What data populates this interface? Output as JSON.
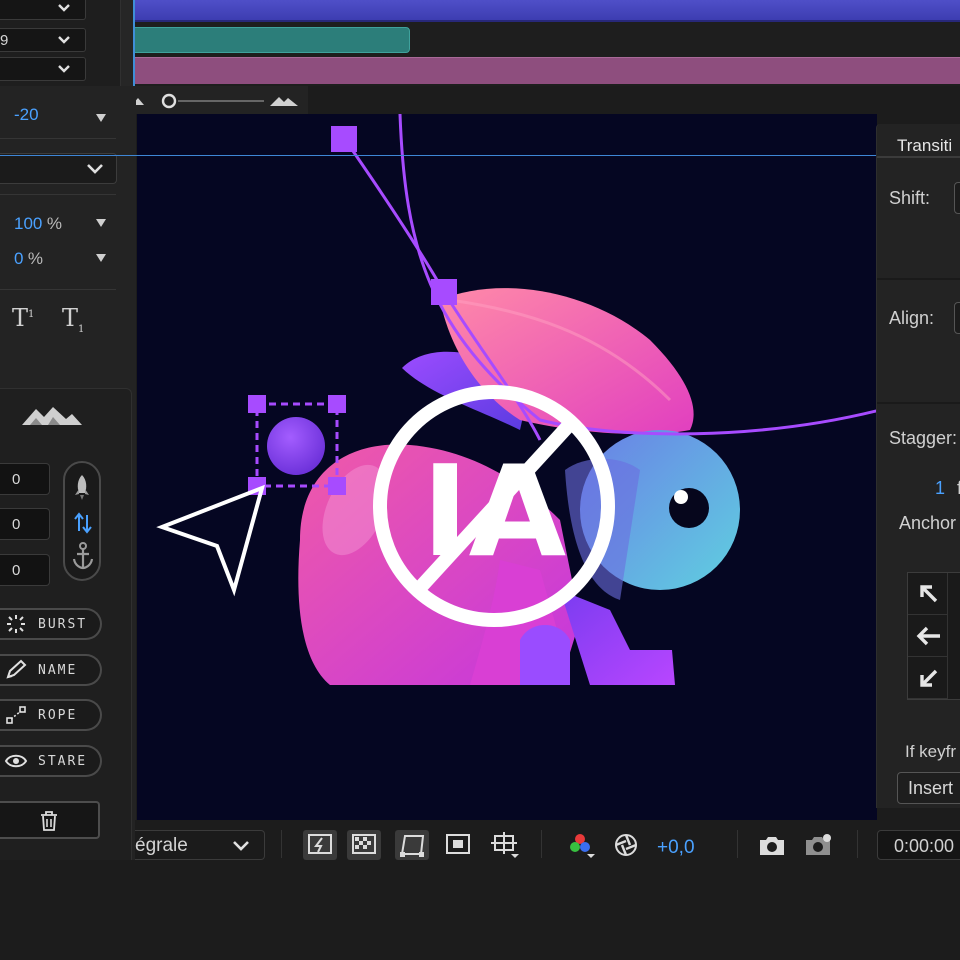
{
  "timeline": {
    "rows": [
      {
        "value": "",
        "menu": "chevron-down-icon"
      },
      {
        "value": "9",
        "menu": "chevron-down-icon"
      },
      {
        "value": "",
        "menu": "chevron-down-icon"
      }
    ]
  },
  "left_panel": {
    "tracking_value": "-20",
    "scale_value": "100",
    "scale_unit": "%",
    "offset_value": "0",
    "offset_unit": "%",
    "superscript_label": "T",
    "subscript_label": "T",
    "plugin": {
      "fields": [
        "0",
        "0",
        "0"
      ],
      "buttons": [
        {
          "label": "BURST",
          "icon": "burst-icon"
        },
        {
          "label": "NAME",
          "icon": "pencil-icon"
        },
        {
          "label": "ROPE",
          "icon": "rope-icon"
        },
        {
          "label": "STARE",
          "icon": "eye-icon"
        }
      ]
    }
  },
  "canvas": {
    "logo_text": "IA",
    "colors": {
      "background": "#050622",
      "accent_purple": "#a74bff",
      "rabbit_pink": "#e24fc9",
      "rabbit_blue": "#5cc0df"
    }
  },
  "right_panel": {
    "title": "Transiti",
    "shift_label": "Shift:",
    "align_label": "Align:",
    "stagger_label": "Stagger:",
    "stagger_value": "1",
    "stagger_unit": "f",
    "anchor_label": "Anchor",
    "keyframe_label": "If keyfr",
    "insert_button": "Insert"
  },
  "bottom_bar": {
    "resolution": "égrale",
    "exposure_value": "+0,0",
    "timecode": "0:00:00"
  }
}
